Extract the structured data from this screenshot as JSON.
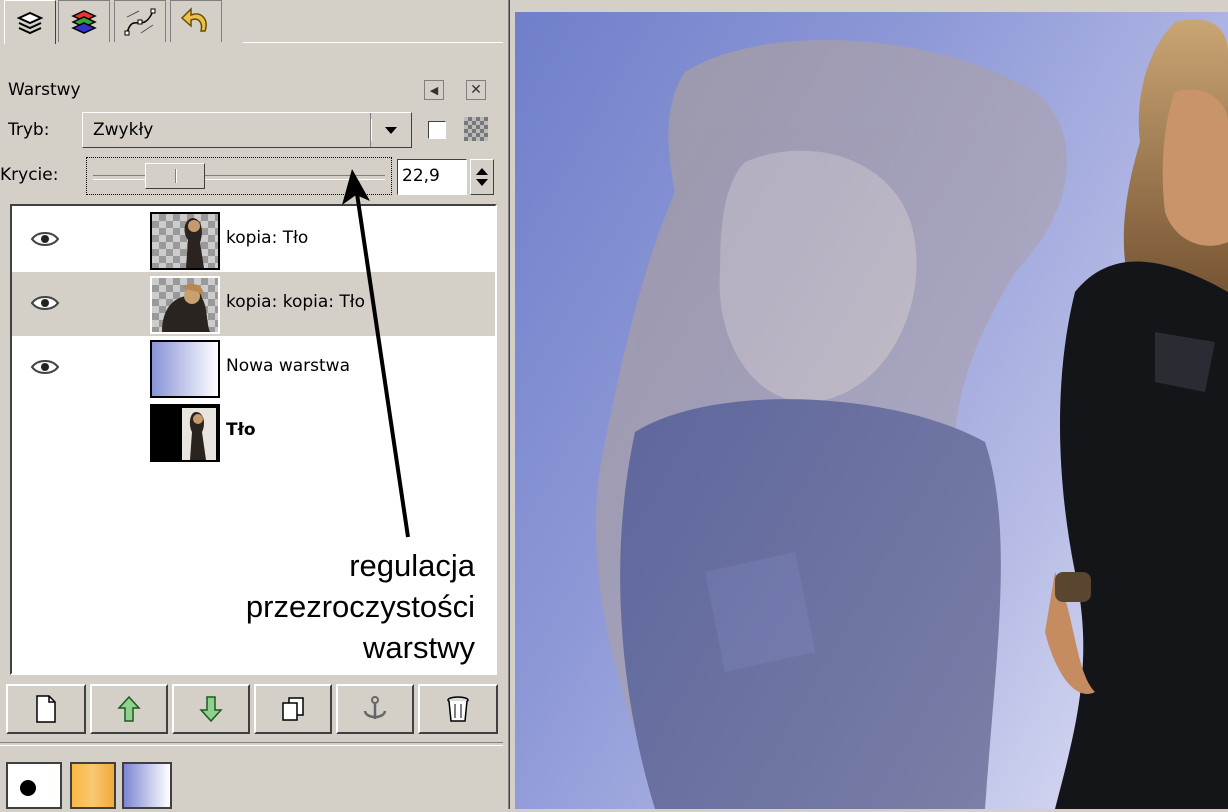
{
  "tabs": [
    {
      "name": "layers",
      "icon": "layers-icon"
    },
    {
      "name": "channels",
      "icon": "channels-icon"
    },
    {
      "name": "paths",
      "icon": "paths-icon"
    },
    {
      "name": "undo-history",
      "icon": "undo-icon"
    }
  ],
  "panel": {
    "title": "Warstwy",
    "mode_label": "Tryb:",
    "mode_value": "Zwykły",
    "opacity_label": "Krycie:",
    "opacity_value": "22,9",
    "opacity_percent": 22.9
  },
  "layers": [
    {
      "name": "kopia: Tło",
      "visible": true,
      "selected": false,
      "bold": false
    },
    {
      "name": "kopia: kopia: Tło",
      "visible": true,
      "selected": true,
      "bold": false
    },
    {
      "name": "Nowa warstwa",
      "visible": true,
      "selected": false,
      "bold": false
    },
    {
      "name": "Tło",
      "visible": false,
      "selected": false,
      "bold": true
    }
  ],
  "annotation": {
    "line1": "regulacja",
    "line2": "przezroczystości",
    "line3": "warstwy"
  },
  "toolbar_icons": [
    "new-layer-icon",
    "raise-layer-icon",
    "lower-layer-icon",
    "duplicate-layer-icon",
    "anchor-layer-icon",
    "delete-layer-icon"
  ],
  "colors": {
    "panel_bg": "#d4d0c8",
    "canvas_blue": "#8d98d7",
    "selected_row": "#d4d0c8"
  }
}
